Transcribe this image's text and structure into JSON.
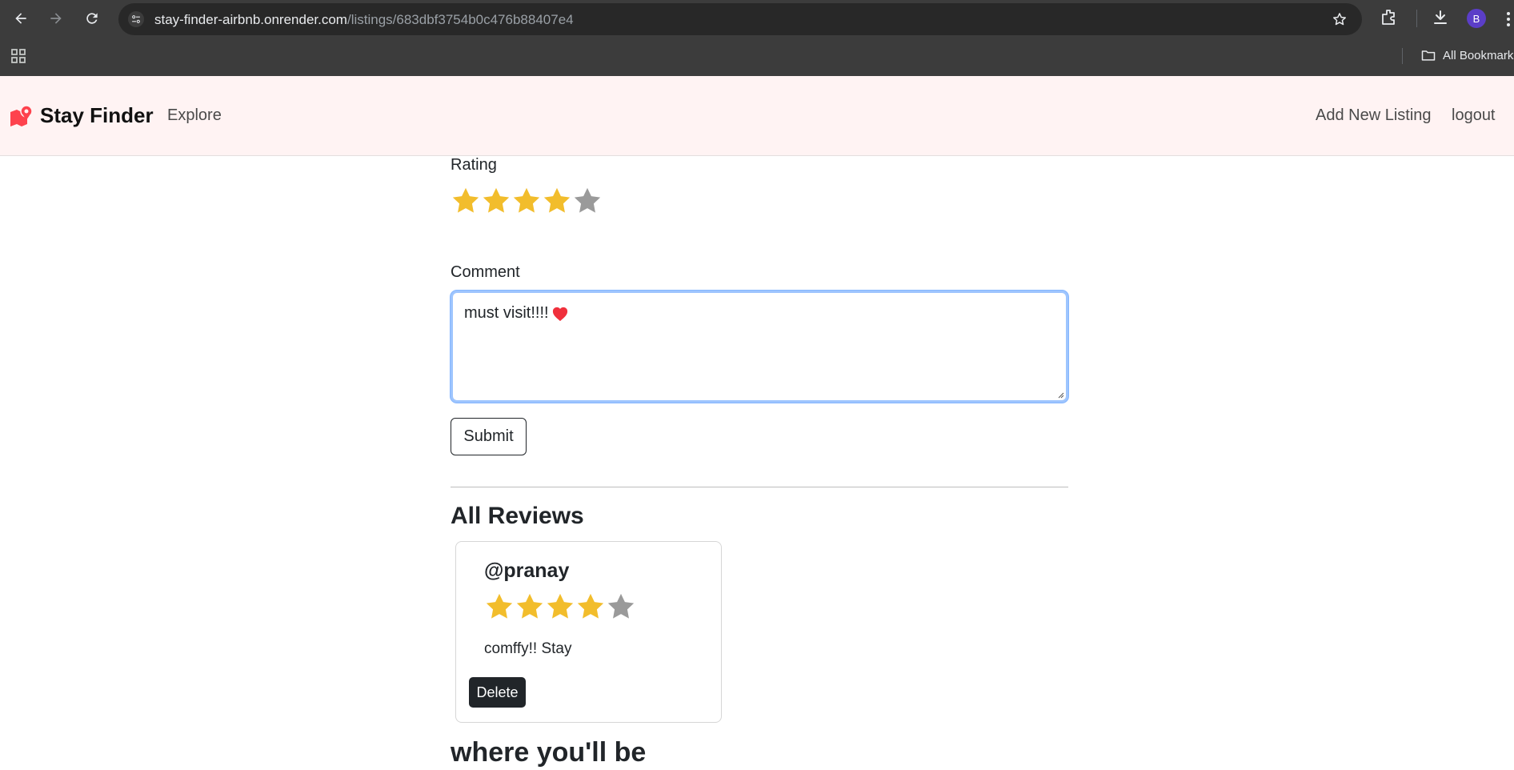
{
  "browser": {
    "url_host": "stay-finder-airbnb.onrender.com",
    "url_path": "/listings/683dbf3754b0c476b88407e4",
    "profile_initial": "B",
    "bookmarks_label": "All Bookmarks"
  },
  "navbar": {
    "brand": "Stay Finder",
    "explore": "Explore",
    "add_listing": "Add New Listing",
    "logout": "logout"
  },
  "review_form": {
    "rating_label": "Rating",
    "rating_value": 4,
    "rating_max": 5,
    "comment_label": "Comment",
    "comment_value": "must visit!!!!",
    "comment_emoji": "heart",
    "submit_label": "Submit"
  },
  "reviews_section": {
    "title": "All Reviews",
    "reviews": [
      {
        "author": "@pranay",
        "rating": 4,
        "rating_max": 5,
        "comment": "comffy!! Stay",
        "delete_label": "Delete"
      }
    ]
  },
  "map_section": {
    "title": "where you'll be"
  },
  "colors": {
    "star_filled": "#f2bd2c",
    "star_empty": "#9a9a9a",
    "navbar_bg": "#fff3f3",
    "brand_icon": "#fe424d"
  }
}
